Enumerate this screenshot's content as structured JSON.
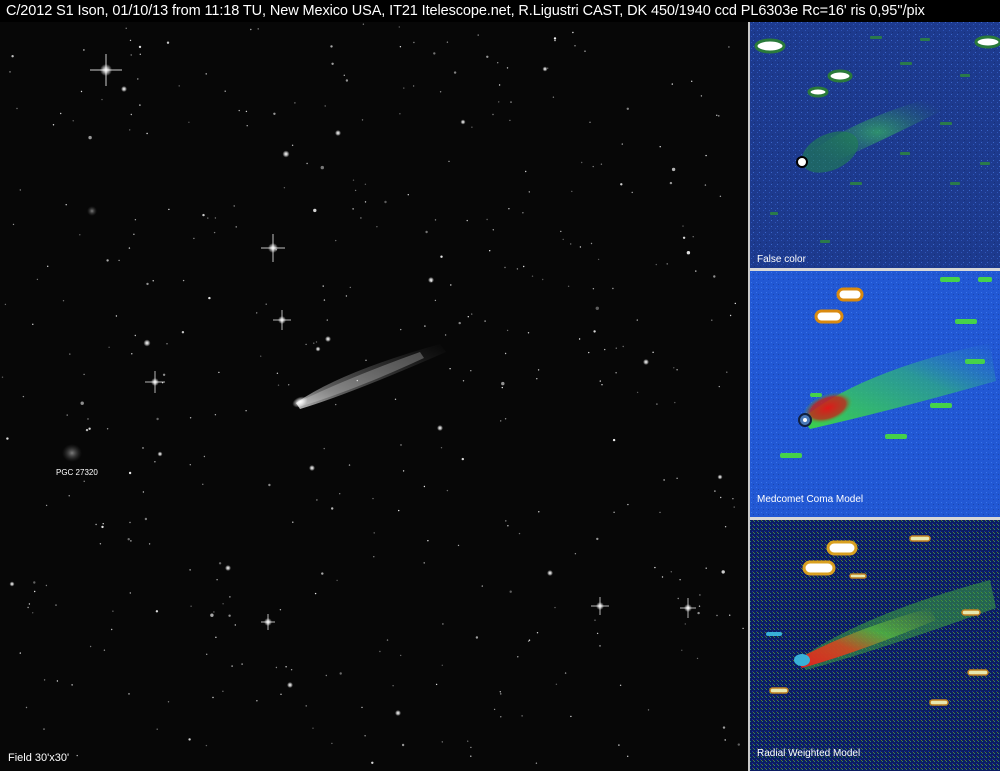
{
  "header": {
    "title": "C/2012 S1 Ison, 01/10/13 from 11:18  TU, New Mexico USA, IT21 Itelescope.net, R.Ligustri CAST, DK 450/1940 ccd PL6303e  Rc=16'    ris 0,95''/pix"
  },
  "main": {
    "galaxy_label": "PGC 27320",
    "field_label": "Field 30'x30'"
  },
  "panels": [
    {
      "label": "False color"
    },
    {
      "label": "Medcomet Coma Model"
    },
    {
      "label": "Radial Weighted Model"
    }
  ],
  "colors": {
    "background": "#000000",
    "false_color_bg": "#1a3a8f",
    "coma_model_bg": "#1f58d8",
    "radial_bg": "#0a1a5a",
    "nucleus_red": "#e0201a",
    "tail_green": "#2fd34a"
  }
}
